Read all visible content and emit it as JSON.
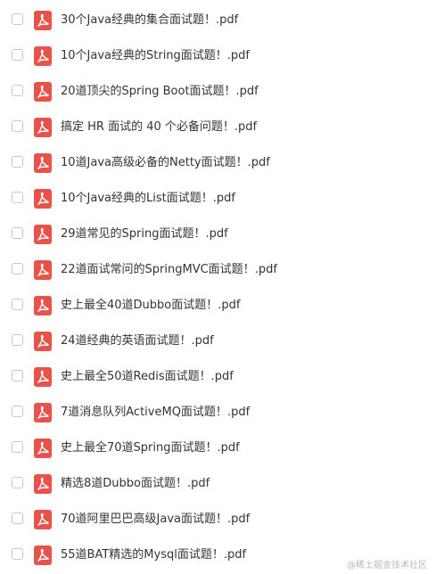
{
  "files": [
    {
      "name": "30个Java经典的集合面试题！.pdf"
    },
    {
      "name": "10个Java经典的String面试题！.pdf"
    },
    {
      "name": "20道顶尖的Spring Boot面试题！.pdf"
    },
    {
      "name": "搞定 HR 面试的 40 个必备问题！.pdf"
    },
    {
      "name": "10道Java高级必备的Netty面试题！.pdf"
    },
    {
      "name": "10个Java经典的List面试题！.pdf"
    },
    {
      "name": "29道常见的Spring面试题！.pdf"
    },
    {
      "name": "22道面试常问的SpringMVC面试题！.pdf"
    },
    {
      "name": "史上最全40道Dubbo面试题！.pdf"
    },
    {
      "name": "24道经典的英语面试题！.pdf"
    },
    {
      "name": "史上最全50道Redis面试题！.pdf"
    },
    {
      "name": "7道消息队列ActiveMQ面试题！.pdf"
    },
    {
      "name": "史上最全70道Spring面试题！.pdf"
    },
    {
      "name": "精选8道Dubbo面试题！.pdf"
    },
    {
      "name": "70道阿里巴巴高级Java面试题！.pdf"
    },
    {
      "name": "55道BAT精选的Mysql面试题！.pdf"
    }
  ],
  "icon": "pdf-file-icon",
  "icon_color": "#e8524a",
  "watermark": "@稀土掘金技术社区"
}
